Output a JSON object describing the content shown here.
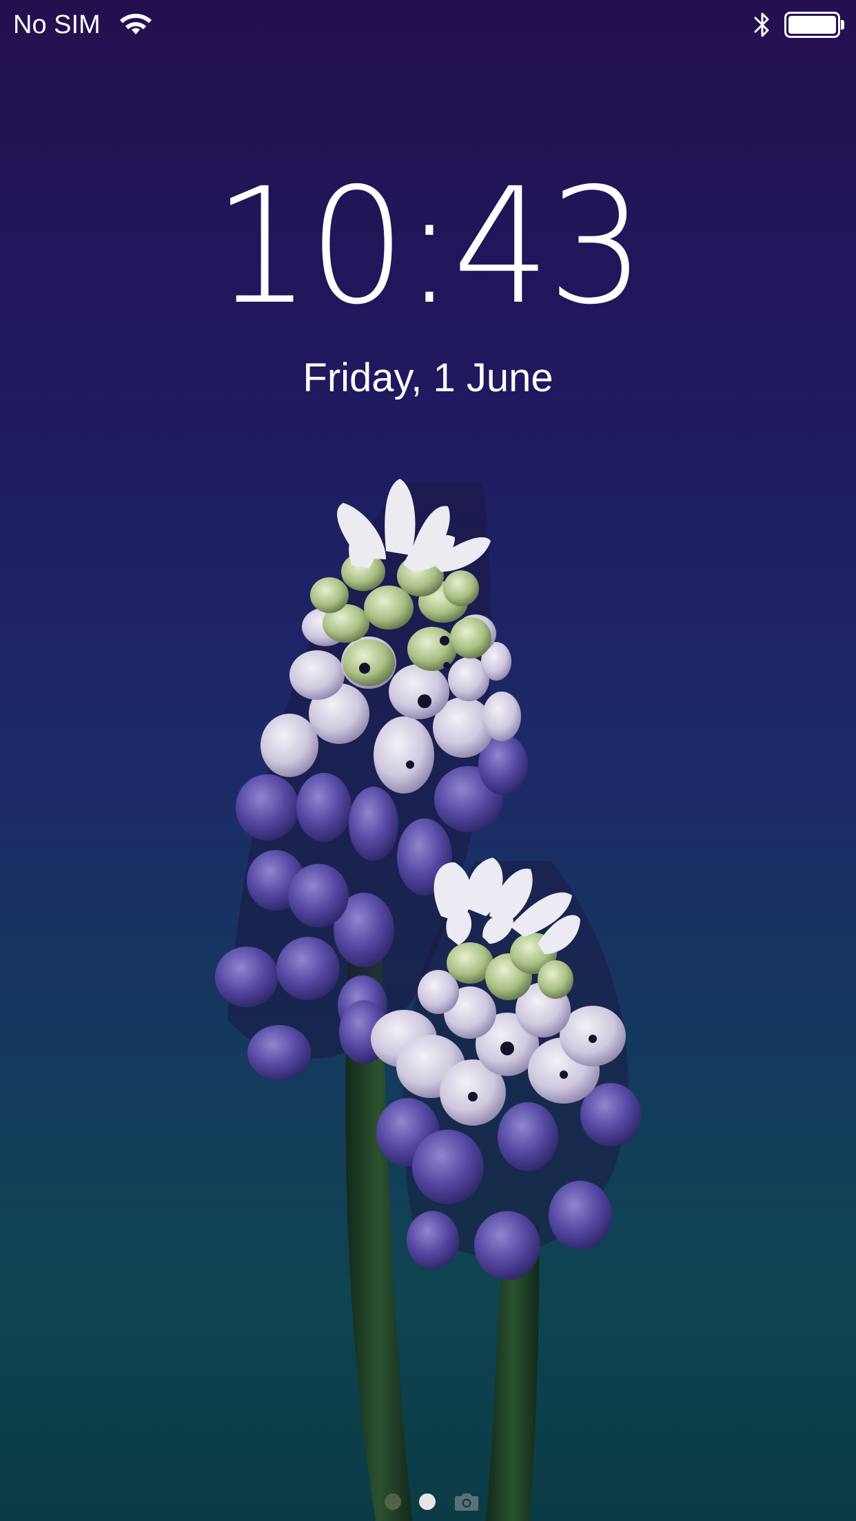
{
  "status_bar": {
    "carrier": "No SIM",
    "wifi_icon": "wifi-icon",
    "bluetooth_icon": "bluetooth-icon",
    "battery_icon": "battery-icon",
    "battery_level": 1.0
  },
  "lock_screen": {
    "time": "10:43",
    "date": "Friday, 1 June"
  },
  "page_indicator": {
    "pages": [
      "notifications",
      "lock",
      "camera"
    ],
    "current_page": "lock",
    "camera_icon": "camera-icon"
  },
  "wallpaper": {
    "subject": "flower-wallpaper",
    "colors": {
      "top": "#24104f",
      "middle": "#1d2a68",
      "bottom": "#0b3b45",
      "petal_light": "#e9e6f2",
      "petal_purple": "#5a4fa8",
      "stem": "#1e3a24"
    }
  }
}
